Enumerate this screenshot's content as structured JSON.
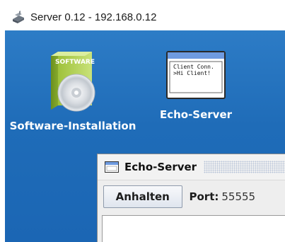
{
  "window": {
    "title": "Server 0.12 - 192.168.0.12",
    "icon": "server-app-icon"
  },
  "desktop": {
    "icons": [
      {
        "label": "Software-Installation",
        "icon": "software-box-cd-icon",
        "box_text": "SOFTWARE"
      },
      {
        "label": "Echo-Server",
        "icon": "echo-server-console-icon",
        "screen_lines": [
          "Client Conn.",
          ">Hi Client!"
        ]
      }
    ]
  },
  "echo_window": {
    "title": "Echo-Server",
    "icon": "window-icon",
    "stop_button": "Anhalten",
    "port_label": "Port:",
    "port_value": "55555"
  },
  "colors": {
    "desktop_blue": "#1f6cb8",
    "window_gray": "#eeeeee"
  }
}
